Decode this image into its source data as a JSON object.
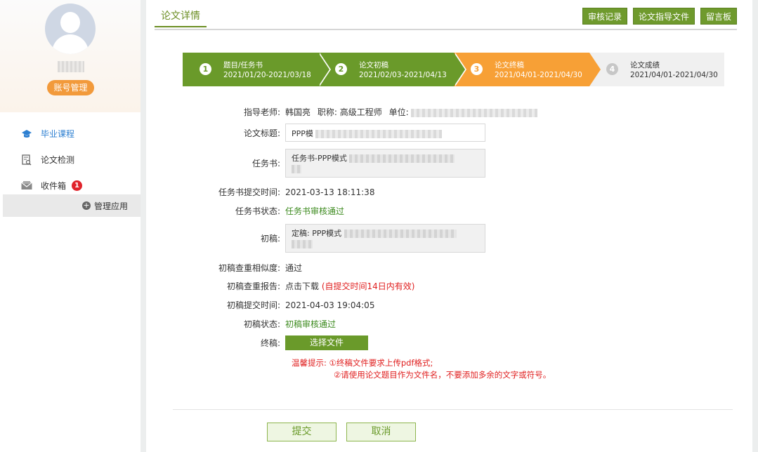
{
  "sidebar": {
    "account_button": "账号管理",
    "items": [
      {
        "label": "毕业课程",
        "icon": "graduation-cap-icon"
      },
      {
        "label": "论文检测",
        "icon": "document-search-icon"
      },
      {
        "label": "收件箱",
        "icon": "mail-icon",
        "badge": "1"
      }
    ],
    "manage_label": "管理应用"
  },
  "header": {
    "tab_title": "论文详情",
    "buttons": [
      "审核记录",
      "论文指导文件",
      "留言板"
    ]
  },
  "steps": [
    {
      "num": "1",
      "title": "题目/任务书",
      "dates": "2021/01/20-2021/03/18",
      "state": "done"
    },
    {
      "num": "2",
      "title": "论文初稿",
      "dates": "2021/02/03-2021/04/13",
      "state": "done"
    },
    {
      "num": "3",
      "title": "论文终稿",
      "dates": "2021/04/01-2021/04/30",
      "state": "current"
    },
    {
      "num": "4",
      "title": "论文成绩",
      "dates": "2021/04/01-2021/04/30",
      "state": "todo"
    }
  ],
  "form": {
    "advisor_label": "指导老师:",
    "advisor_name": "韩国亮",
    "title_label_inline": "职称:",
    "title_value": "高级工程师",
    "unit_label": "单位:",
    "thesis_title_label": "论文标题:",
    "thesis_title_value": "PPP模",
    "task_label": "任务书:",
    "task_value": "任务书-PPP模式",
    "task_time_label": "任务书提交时间:",
    "task_time_value": "2021-03-13 18:11:38",
    "task_status_label": "任务书状态:",
    "task_status_value": "任务书审核通过",
    "draft_label": "初稿:",
    "draft_value": "定稿: PPP模式",
    "similarity_label": "初稿查重相似度:",
    "similarity_value": "通过",
    "report_label": "初稿查重报告:",
    "report_link": "点击下载",
    "report_note": "(自提交时间14日内有效)",
    "draft_time_label": "初稿提交时间:",
    "draft_time_value": "2021-04-03 19:04:05",
    "draft_status_label": "初稿状态:",
    "draft_status_value": "初稿审核通过",
    "final_label": "终稿:",
    "select_file_button": "选择文件",
    "tips_line1": "温馨提示: ①终稿文件要求上传pdf格式;",
    "tips_line2": "②请使用论文题目作为文件名，不要添加多余的文字或符号。"
  },
  "footer": {
    "submit_button": "提交",
    "cancel_button": "取消"
  },
  "colors": {
    "accent_green": "#6a9a2a",
    "current_orange": "#f7a036",
    "warning_red": "#e02020"
  }
}
